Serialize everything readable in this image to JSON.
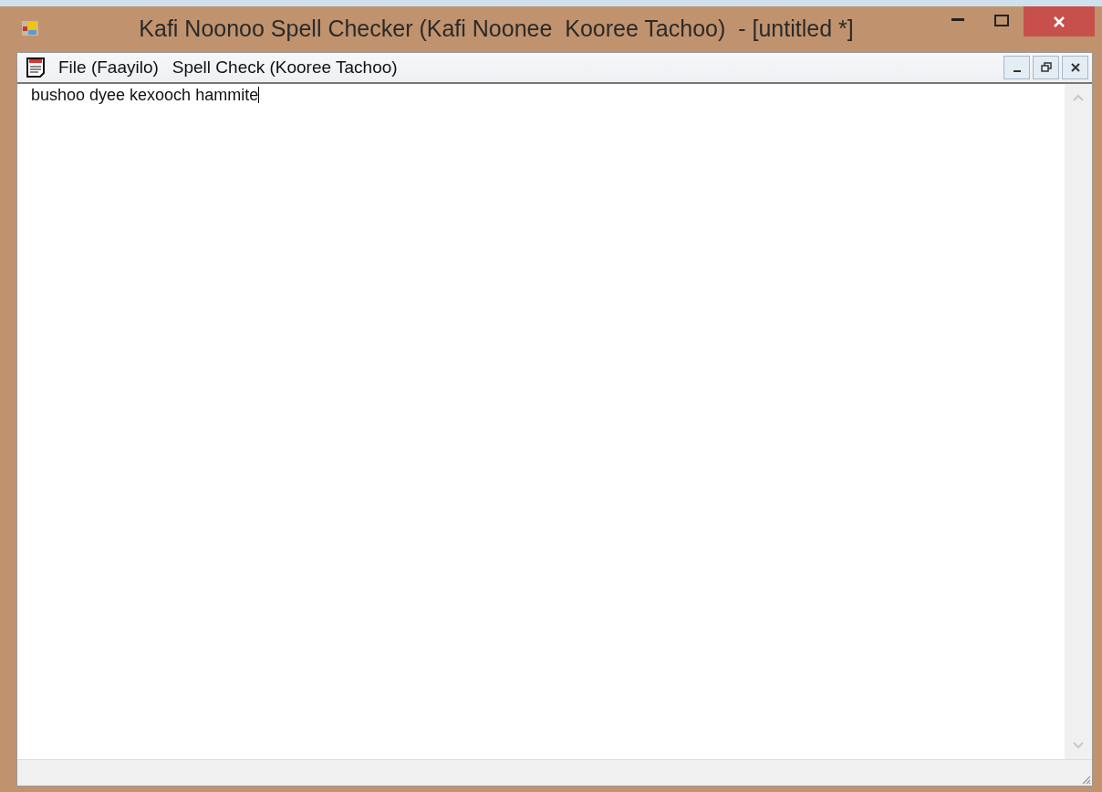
{
  "window": {
    "title": "Kafi Noonoo Spell Checker (Kafi Noonee  Kooree Tachoo)  - [untitled *]"
  },
  "menu": [
    "File (Faayilo)",
    "Spell Check (Kooree Tachoo)"
  ],
  "document": {
    "text": "bushoo dyee kexooch hammite"
  }
}
